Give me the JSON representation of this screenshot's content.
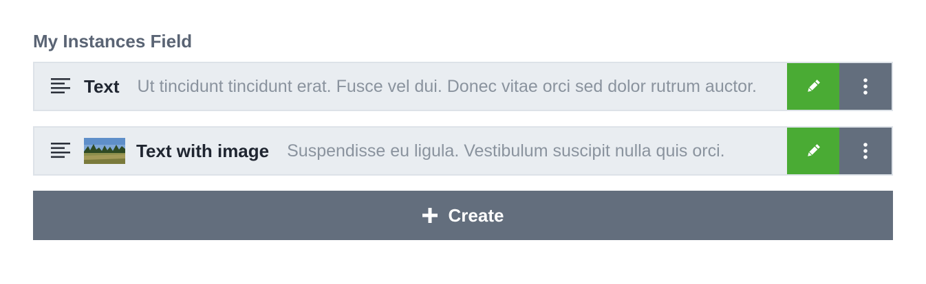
{
  "field": {
    "label": "My Instances Field"
  },
  "instances": [
    {
      "type_icon": "align-left-icon",
      "title": "Text",
      "summary": "Ut tincidunt tincidunt erat. Fusce vel dui. Donec vitae orci sed dolor rutrum auctor.",
      "has_thumbnail": false
    },
    {
      "type_icon": "align-left-icon",
      "title": "Text with image",
      "summary": "Suspendisse eu ligula. Vestibulum suscipit nulla quis orci.",
      "has_thumbnail": true,
      "thumbnail": "landscape-thumbnail"
    }
  ],
  "actions": {
    "edit_icon": "pencil-icon",
    "more_icon": "vertical-ellipsis-icon"
  },
  "create_button": {
    "label": "Create",
    "icon": "plus-icon"
  },
  "colors": {
    "edit": "#4aab34",
    "more": "#636e7d",
    "create": "#636e7d",
    "row_bg": "#e9edf1"
  }
}
